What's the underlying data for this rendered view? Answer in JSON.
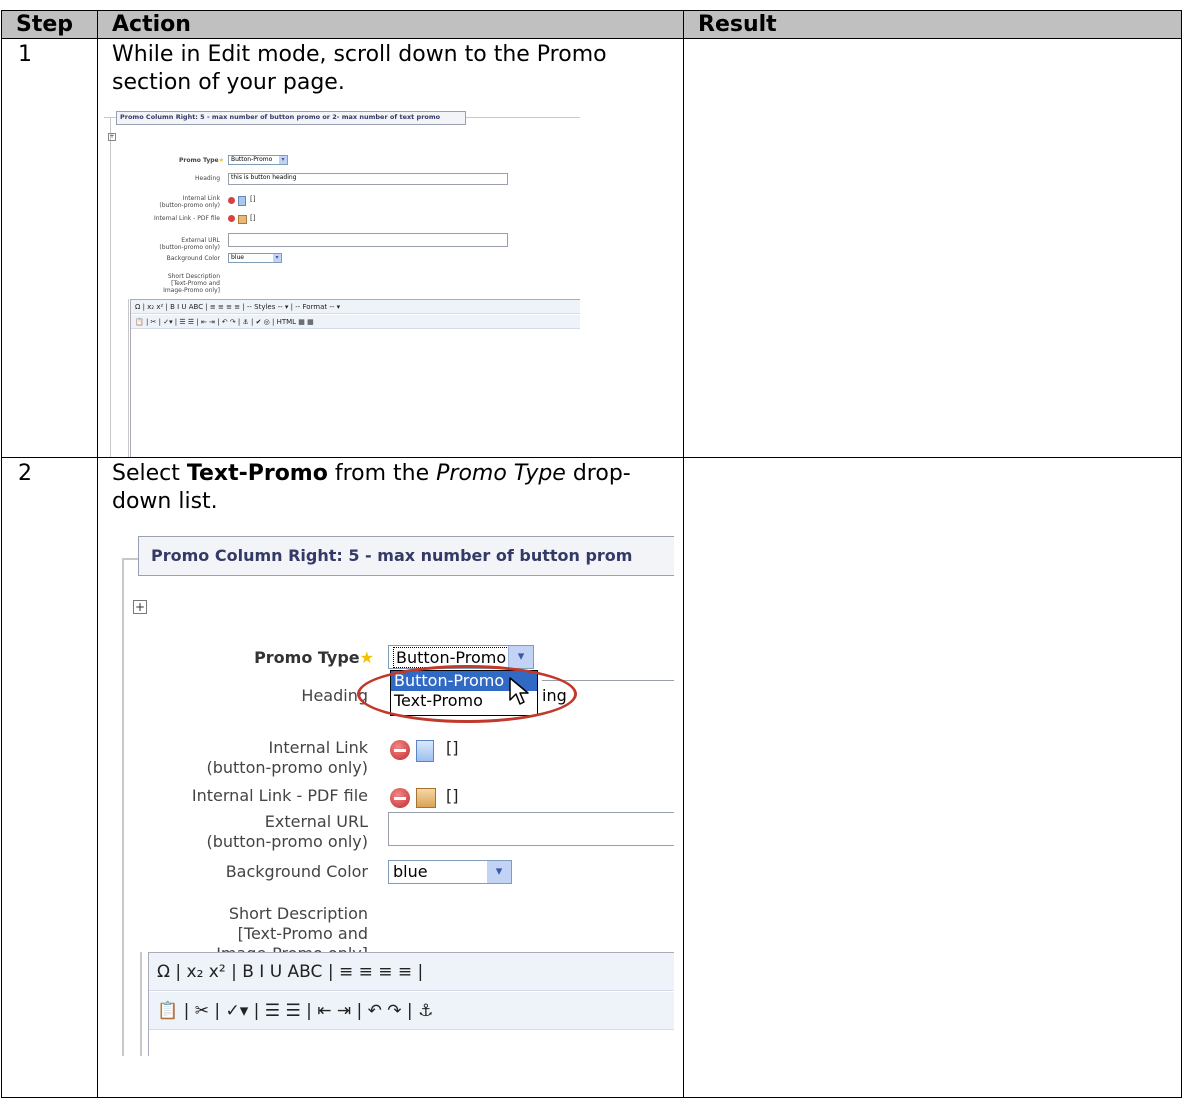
{
  "table": {
    "headers": [
      "Step",
      "Action",
      "Result"
    ],
    "rows": [
      {
        "step": "1",
        "action_text": "While in Edit mode, scroll down to the Promo section of your page.",
        "result": ""
      },
      {
        "step": "2",
        "action_pre": "Select ",
        "action_bold": "Text-Promo",
        "action_mid": " from the ",
        "action_italic": "Promo Type",
        "action_post": " drop-down list.",
        "result": ""
      }
    ]
  },
  "screenshot1": {
    "panel_title": "Promo Column Right: 5 - max number of button promo or 2- max number of text promo",
    "plus": "+",
    "promo_type_label": "Promo Type",
    "promo_type_value": "Button-Promo",
    "heading_label": "Heading",
    "heading_value": "this is button heading",
    "internal_link_label": "Internal Link",
    "internal_link_sub": "(button-promo only)",
    "pdf_label": "Internal Link - PDF file",
    "brackets": "[]",
    "external_url_label": "External URL",
    "external_url_sub": "(button-promo only)",
    "bg_color_label": "Background Color",
    "bg_color_value": "blue",
    "short_desc_1": "Short Description",
    "short_desc_2": "[Text-Promo and",
    "short_desc_3": "Image-Promo only]",
    "toolbar_row1": "Ω | x₂ x² | B I U ABC | ≡ ≡ ≡ ≡ | -- Styles -- ▾ | -- Format -- ▾",
    "toolbar_row2": "📋 | ✂ | ✓▾ | ☰ ☰ | ⇤ ⇥ | ↶ ↷ | ⚓ | ✔ ◎ | HTML ▦ ▦"
  },
  "screenshot2": {
    "panel_title": "Promo Column Right: 5 - max number of button prom",
    "plus": "+",
    "promo_type_label": "Promo Type",
    "promo_type_value": "Button-Promo",
    "dropdown_options": [
      "Button-Promo",
      "Text-Promo"
    ],
    "heading_label": "Heading",
    "heading_partial_value": "ing",
    "internal_link_label": "Internal Link",
    "internal_link_sub": "(button-promo only)",
    "pdf_label": "Internal Link - PDF file",
    "brackets": "[]",
    "external_url_label": "External URL",
    "external_url_sub": "(button-promo only)",
    "bg_color_label": "Background Color",
    "bg_color_value": "blue",
    "short_desc_1": "Short Description",
    "short_desc_2": "[Text-Promo and",
    "short_desc_3": "Image-Promo only]",
    "toolbar_row1": "Ω | x₂ x² | B I U ABC | ≡ ≡ ≡ ≡ |",
    "toolbar_row2": "📋 | ✂ | ✓▾ | ☰ ☰ | ⇤ ⇥ | ↶ ↷ | ⚓"
  },
  "colors": {
    "header_bg": "#c0c0c0",
    "highlight_oval": "#c0392b",
    "selected_option": "#316ac5"
  }
}
